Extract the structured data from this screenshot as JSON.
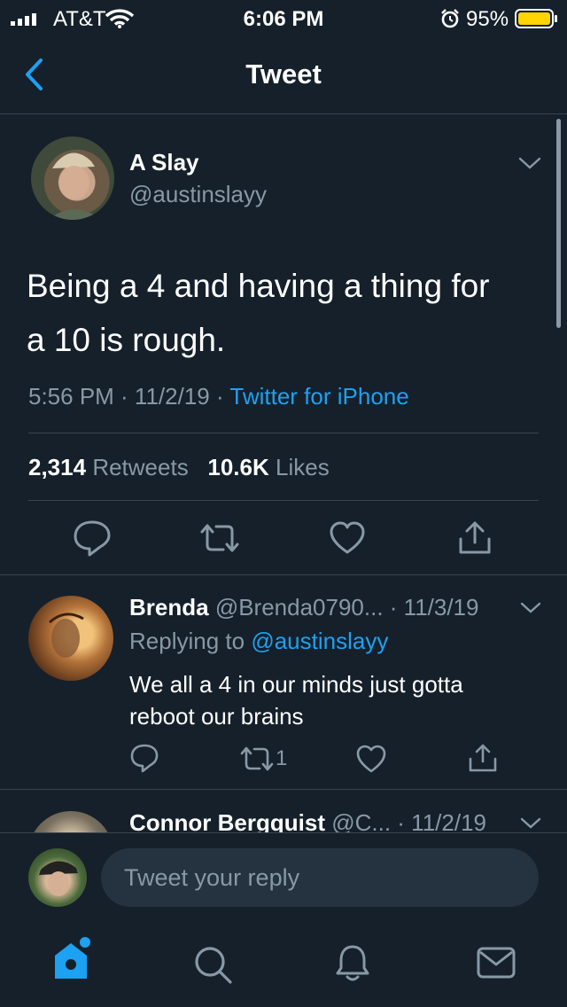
{
  "status_bar": {
    "carrier": "AT&T",
    "time": "6:06 PM",
    "battery": "95%"
  },
  "nav": {
    "title": "Tweet"
  },
  "tweet": {
    "author_name": "A Slay",
    "author_handle": "@austinslayy",
    "text_line1": "Being a 4 and having a thing for",
    "text_line2": "a 10 is rough.",
    "meta_time": "5:56 PM · 11/2/19 · ",
    "meta_source": "Twitter for iPhone",
    "retweets_count": "2,314",
    "retweets_label": "Retweets",
    "likes_count": "10.6K",
    "likes_label": "Likes"
  },
  "replies": [
    {
      "name": "Brenda",
      "handle_date": "@Brenda0790... · 11/3/19",
      "replying_prefix": "Replying to ",
      "replying_handle": "@austinslayy",
      "text_line1": "We all a 4 in our minds just gotta",
      "text_line2": "reboot our brains",
      "retweet_count": "1"
    },
    {
      "name": "Connor Bergquist",
      "handle_date": "@C... · 11/2/19"
    }
  ],
  "compose": {
    "placeholder": "Tweet your reply"
  },
  "colors": {
    "background": "#15202b",
    "accent": "#1da1f2",
    "muted": "#8899a6",
    "divider": "#38444d",
    "battery": "#ffd400"
  }
}
